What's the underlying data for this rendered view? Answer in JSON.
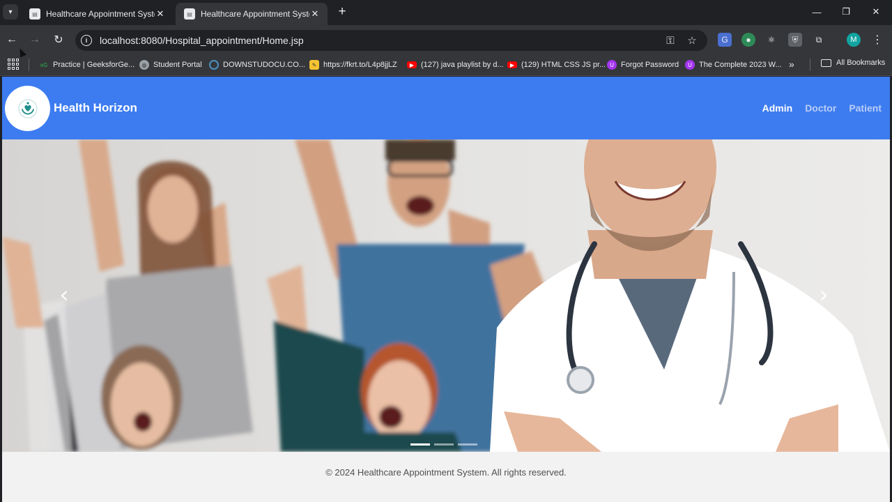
{
  "browser": {
    "tabs": [
      {
        "title": "Healthcare Appointment System",
        "active": false
      },
      {
        "title": "Healthcare Appointment System",
        "active": true
      }
    ],
    "url": "localhost:8080/Hospital_appointment/Home.jsp",
    "profile_initial": "M",
    "bookmarks": [
      {
        "label": "Practice | GeeksforGe...",
        "icon": "gfg-icon",
        "color": "#2f8d46"
      },
      {
        "label": "Student Portal",
        "icon": "globe-icon",
        "color": "#9aa0a6"
      },
      {
        "label": "DOWNSTUDOCU.CO...",
        "icon": "studocu-icon",
        "color": "#4a90c2"
      },
      {
        "label": "https://fkrt.to/L4p8jjLZ",
        "icon": "sticky-note-icon",
        "color": "#f4c430"
      },
      {
        "label": "(127) java playlist by d...",
        "icon": "youtube-icon",
        "color": "#ff0000"
      },
      {
        "label": "(129) HTML CSS JS pr...",
        "icon": "youtube-icon",
        "color": "#ff0000"
      },
      {
        "label": "Forgot Password",
        "icon": "udemy-icon",
        "color": "#a435f0"
      },
      {
        "label": "The Complete 2023 W...",
        "icon": "udemy-icon",
        "color": "#a435f0"
      }
    ],
    "all_bookmarks": "All Bookmarks"
  },
  "site": {
    "brand": "Health Horizon",
    "nav": [
      {
        "label": "Admin",
        "active": true
      },
      {
        "label": "Doctor",
        "active": false
      },
      {
        "label": "Patient",
        "active": false
      }
    ],
    "carousel": {
      "slide_count": 3,
      "active_slide": 1
    },
    "footer": "© 2024 Healthcare Appointment System. All rights reserved."
  },
  "colors": {
    "header_blue": "#3d7cf0",
    "chrome_dark": "#202124",
    "chrome_toolbar": "#35363a"
  }
}
